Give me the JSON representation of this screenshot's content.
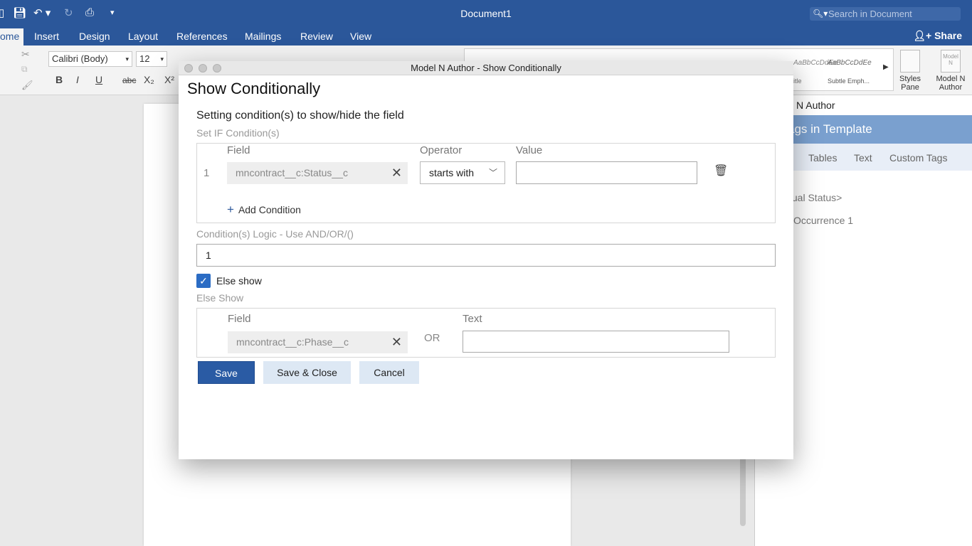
{
  "window": {
    "doc_title": "Document1",
    "search_placeholder": "Search in Document",
    "share_label": "Share"
  },
  "tabs": [
    "ome",
    "Insert",
    "Design",
    "Layout",
    "References",
    "Mailings",
    "Review",
    "View"
  ],
  "ribbon": {
    "font_name": "Calibri (Body)",
    "font_size": "12",
    "format_buttons": [
      "B",
      "I",
      "U",
      "abc",
      "X₂",
      "X²"
    ],
    "style_samples": [
      "AaBbCcDdEe",
      "AaBbCcDdEe"
    ],
    "style_names": [
      "itle",
      "Subtle Emph..."
    ],
    "styles_pane": "Styles\nPane",
    "model_n": "Model N\nAuthor",
    "model_n_logo": "Model N"
  },
  "side_pane": {
    "title": "N Author",
    "header": "ags in Template",
    "tabs": [
      "Tables",
      "Text",
      "Custom Tags"
    ],
    "items": [
      "tual Status>",
      "Occurrence 1"
    ]
  },
  "dialog": {
    "window_title": "Model N Author - Show Conditionally",
    "heading": "Show Conditionally",
    "subheading": "Setting condition(s) to show/hide the field",
    "if_label": "Set IF Condition(s)",
    "columns": {
      "field": "Field",
      "operator": "Operator",
      "value": "Value"
    },
    "condition": {
      "row_number": "1",
      "field": "mncontract__c:Status__c",
      "operator": "starts with",
      "value": ""
    },
    "add_condition": "Add Condition",
    "logic_label": "Condition(s) Logic - Use AND/OR/()",
    "logic_value": "1",
    "else_checkbox_label": "Else show",
    "else_checked": true,
    "else_section_label": "Else Show",
    "else_columns": {
      "field": "Field",
      "text": "Text"
    },
    "else_field": "mncontract__c:Phase__c",
    "or_label": "OR",
    "else_text": "",
    "buttons": {
      "save": "Save",
      "save_close": "Save & Close",
      "cancel": "Cancel"
    }
  },
  "colors": {
    "brand": "#2b579a",
    "primary_button": "#2a5ba4",
    "secondary_button": "#dde8f4",
    "checkbox": "#2b6cc4"
  }
}
